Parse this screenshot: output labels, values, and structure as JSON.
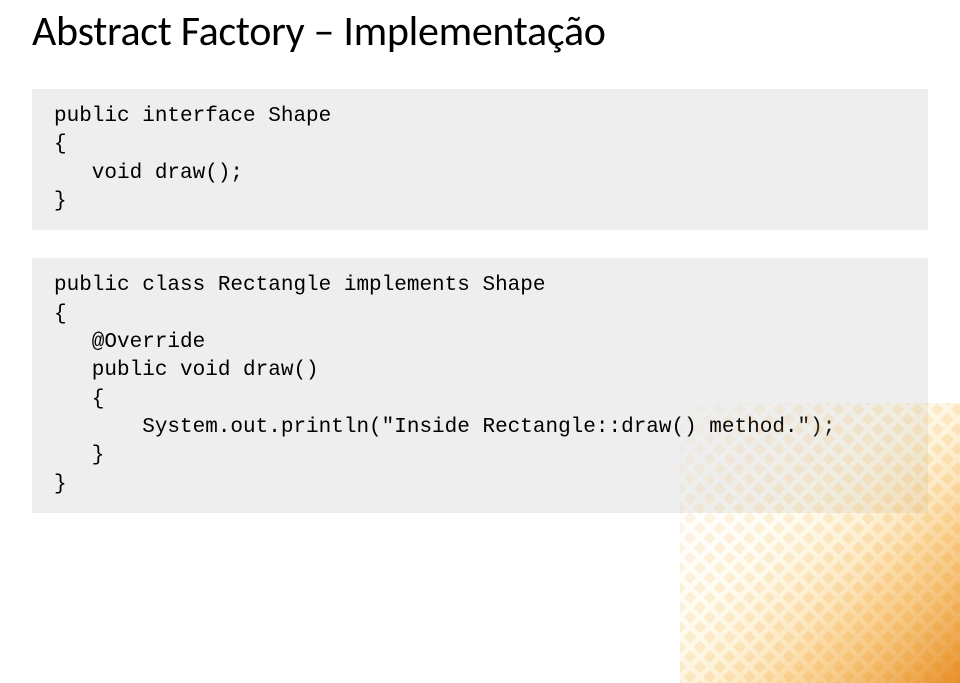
{
  "title": "Abstract Factory – Implementação",
  "code_block_1": "public interface Shape\n{\n   void draw();\n}",
  "code_block_2": "public class Rectangle implements Shape\n{\n   @Override\n   public void draw()\n   {\n       System.out.println(\"Inside Rectangle::draw() method.\");\n   }\n}"
}
